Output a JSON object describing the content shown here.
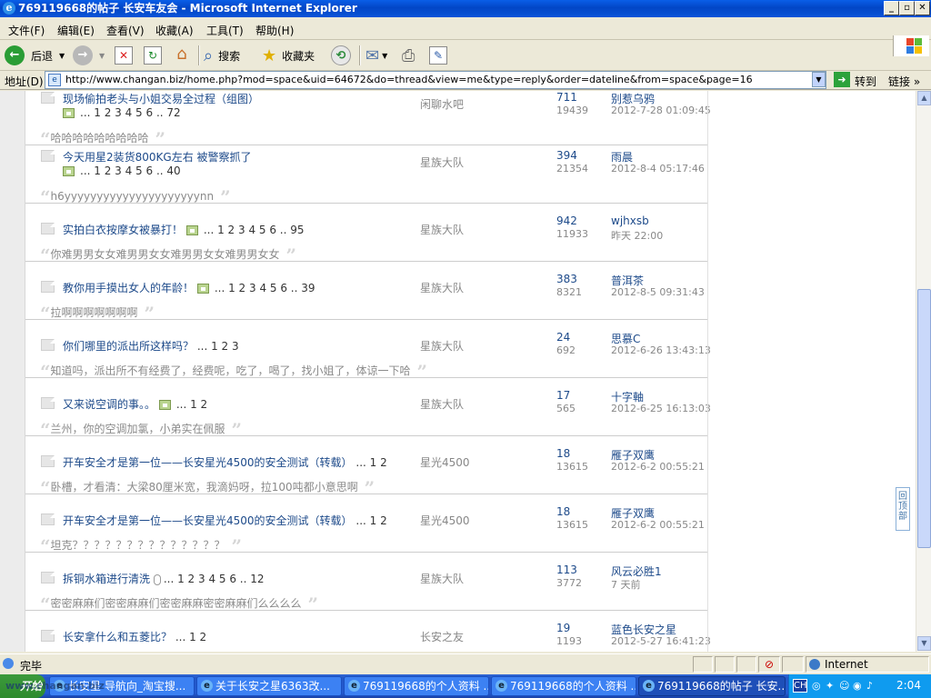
{
  "window": {
    "title": "769119668的帖子 长安车友会 - Microsoft Internet Explorer"
  },
  "menu": [
    "文件(F)",
    "编辑(E)",
    "查看(V)",
    "收藏(A)",
    "工具(T)",
    "帮助(H)"
  ],
  "toolbar": {
    "back": "后退",
    "search": "搜索",
    "favorites": "收藏夹"
  },
  "address": {
    "label": "地址(D)",
    "url": "http://www.changan.biz/home.php?mod=space&uid=64672&do=thread&view=me&type=reply&order=dateline&from=space&page=16",
    "go": "转到",
    "links": "链接"
  },
  "rows": [
    {
      "title": "现场偷拍老头与小姐交易全过程（组图）",
      "img": true,
      "pages": "... 1 2 3 4 5 6 .. 72",
      "inline_pages": false,
      "quote": "哈哈哈哈哈哈哈哈哈",
      "forum": "闲聊水吧",
      "replies": "711",
      "views": "19439",
      "author": "别惹乌鸦",
      "time": "2012-7-28 01:09:45"
    },
    {
      "title": "今天用星2装货800KG左右 被警察抓了",
      "img": true,
      "pages": "... 1 2 3 4 5 6 .. 40",
      "inline_pages": false,
      "quote": "h6yyyyyyyyyyyyyyyyyyyyynn",
      "forum": "星族大队",
      "replies": "394",
      "views": "21354",
      "author": "雨晨",
      "time": "2012-8-4 05:17:46"
    },
    {
      "title": "实拍白衣按摩女被暴打！",
      "img": true,
      "pages": "... 1 2 3 4 5 6 .. 95",
      "inline_pages": true,
      "quote": "你难男男女女难男男女女难男男女女难男男女女",
      "forum": "星族大队",
      "replies": "942",
      "views": "11933",
      "author": "wjhxsb",
      "time": "昨天 22:00"
    },
    {
      "title": "教你用手摸出女人的年龄！",
      "img": true,
      "pages": "... 1 2 3 4 5 6 .. 39",
      "inline_pages": true,
      "quote": "拉啊啊啊啊啊啊啊",
      "forum": "星族大队",
      "replies": "383",
      "views": "8321",
      "author": "普洱茶",
      "time": "2012-8-5 09:31:43"
    },
    {
      "title": "你们哪里的派出所这样吗？",
      "img": false,
      "pages": "... 1 2 3",
      "inline_pages": true,
      "quote": "知道吗，派出所不有经费了，经费呢，吃了，喝了，找小姐了，体谅一下哈",
      "forum": "星族大队",
      "replies": "24",
      "views": "692",
      "author": "思慕C",
      "time": "2012-6-26 13:43:13"
    },
    {
      "title": "又来说空调的事。。",
      "img": true,
      "pages": "... 1 2",
      "inline_pages": true,
      "quote": "兰州，你的空调加氯，小弟实在佩服",
      "forum": "星族大队",
      "replies": "17",
      "views": "565",
      "author": "十字軸",
      "time": "2012-6-25 16:13:03"
    },
    {
      "title": "开车安全才是第一位——长安星光4500的安全测试（转载）",
      "img": false,
      "pages": "... 1 2",
      "inline_pages": true,
      "quote": "卧槽，才看清：大梁80厘米宽，我滴妈呀，拉100吨都小意思啊",
      "forum": "星光4500",
      "replies": "18",
      "views": "13615",
      "author": "雁子双鹰",
      "time": "2012-6-2 00:55:21"
    },
    {
      "title": "开车安全才是第一位——长安星光4500的安全测试（转载）",
      "img": false,
      "pages": "... 1 2",
      "inline_pages": true,
      "quote": "坦克？？？？？？？？？？？？？？",
      "forum": "星光4500",
      "replies": "18",
      "views": "13615",
      "author": "雁子双鹰",
      "time": "2012-6-2 00:55:21"
    },
    {
      "title": "拆铜水箱进行清洗",
      "img": false,
      "attach": true,
      "pages": "... 1 2 3 4 5 6 .. 12",
      "inline_pages": true,
      "quote": "密密麻麻们密密麻麻们密密麻麻密密麻麻们么么么么",
      "forum": "星族大队",
      "replies": "113",
      "views": "3772",
      "author": "风云必胜1",
      "time": "7 天前"
    },
    {
      "title": "长安拿什么和五菱比？",
      "img": false,
      "pages": "... 1 2",
      "inline_pages": true,
      "quote": "",
      "forum": "长安之友",
      "replies": "19",
      "views": "1193",
      "author": "蓝色长安之星",
      "time": "2012-5-27 16:41:23"
    }
  ],
  "backtop": "回顶部",
  "status": {
    "text": "完毕",
    "zone": "Internet"
  },
  "taskbar": {
    "start": "开始",
    "watermark": "www.changan.biz",
    "tasks": [
      "长安星 导航向_淘宝搜...",
      "关于长安之星6363改...",
      "769119668的个人资料 ...",
      "769119668的个人资料 ...",
      "769119668的帖子 长安..."
    ],
    "clock": "2:04",
    "lang": "CH"
  }
}
